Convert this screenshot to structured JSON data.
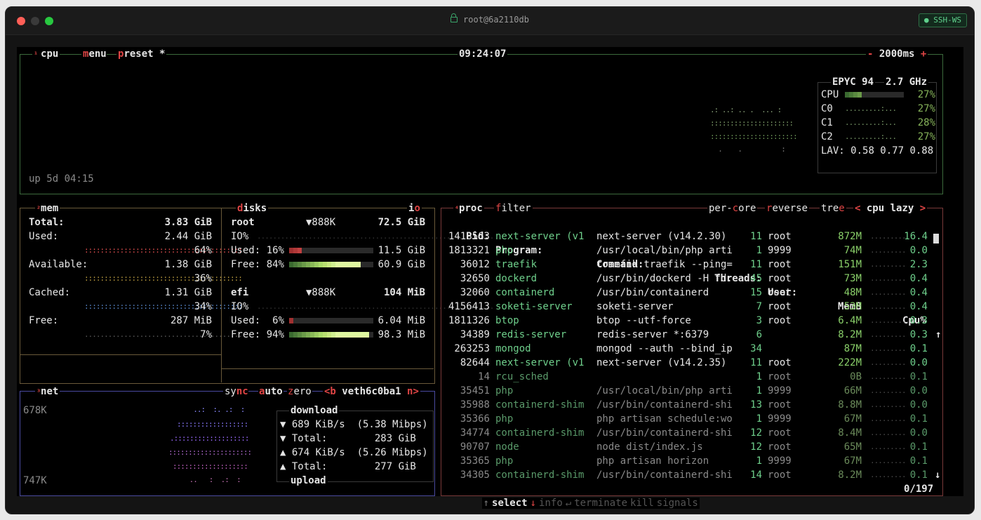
{
  "window": {
    "title": "root@6a2110db",
    "badge": "● SSH-WS",
    "colors": {
      "close": "#ff5f57",
      "minimize": "#3a3a3a",
      "zoom": "#28c840"
    }
  },
  "cpu": {
    "num": "¹",
    "title": "cpu",
    "menu_hot": "m",
    "menu": "enu",
    "preset_hot": "p",
    "preset": "reset *",
    "clock": "09:24:07",
    "minus": "-",
    "interval": "2000ms",
    "plus": "+",
    "uptime": "up 5d 04:15",
    "model": "EPYC 94",
    "freq": "2.7 GHz",
    "cores": [
      {
        "label": "CPU",
        "pct": "27%",
        "value": 27
      },
      {
        "label": "C0",
        "pct": "27%",
        "value": 27
      },
      {
        "label": "C1",
        "pct": "28%",
        "value": 28
      },
      {
        "label": "C2",
        "pct": "27%",
        "value": 27
      }
    ],
    "lav_label": "LAV:",
    "lav": "0.58 0.77 0.88"
  },
  "mem": {
    "num": "²",
    "title": "mem",
    "disks_hot": "d",
    "disks": "isks",
    "io_pre": "i",
    "io_hot": "o",
    "rows": [
      {
        "label": "Total:",
        "value": "3.83 GiB"
      },
      {
        "label": "Used:",
        "value": "2.44 GiB",
        "pct": "64%",
        "value_pct": 64
      },
      {
        "label": "Available:",
        "value": "1.38 GiB",
        "pct": "36%",
        "value_pct": 36
      },
      {
        "label": "Cached:",
        "value": "1.31 GiB",
        "pct": "34%",
        "value_pct": 34
      },
      {
        "label": "Free:",
        "value": "287 MiB",
        "pct": "7%",
        "value_pct": 7
      }
    ],
    "disk_list": [
      {
        "name": "root",
        "io_rate": "▼888K",
        "size": "72.5 GiB",
        "io_label": "IO%",
        "used_label": "Used:",
        "used_pct": "16%",
        "used_value": 16,
        "used": "11.5 GiB",
        "free_label": "Free:",
        "free_pct": "84%",
        "free_value": 84,
        "free": "60.9 GiB"
      },
      {
        "name": "efi",
        "io_rate": "▼888K",
        "size": "104 MiB",
        "io_label": "IO%",
        "used_label": "Used:",
        "used_pct": "6%",
        "used_value": 6,
        "used": "6.04 MiB",
        "free_label": "Free:",
        "free_pct": "94%",
        "free_value": 94,
        "free": "98.3 MiB"
      }
    ]
  },
  "net": {
    "num": "³",
    "title": "net",
    "sync_hot": "sy",
    "sync_rest": "nc",
    "auto_hot": "a",
    "auto": "uto",
    "zero_hot": "z",
    "zero": "ero",
    "prev": "<b",
    "iface": "veth6c0ba1",
    "next": "n>",
    "top_scale": "678K",
    "bottom_scale": "747K",
    "download": "download",
    "dl_rate": "▼ 689 KiB/s  (5.38 Mibps)",
    "dl_total": "▼ Total:        283 GiB",
    "ul_rate": "▲ 674 KiB/s  (5.26 Mibps)",
    "ul_total": "▲ Total:        277 GiB",
    "upload": "upload"
  },
  "proc": {
    "num": "⁴",
    "title": "proc",
    "filter_hot": "f",
    "filter": "ilter",
    "percore_pre": "per-",
    "percore_hot": "c",
    "percore_post": "ore",
    "reverse_hot": "r",
    "reverse": "everse",
    "tree_pre": "tre",
    "tree_hot": "e",
    "sort_left": "<",
    "sort": "cpu lazy",
    "sort_right": ">",
    "headers": {
      "pid": "Pid:",
      "program": "Program:",
      "command": "Command:",
      "threads": "Threads:",
      "user": "User:",
      "memb": "MemB",
      "cpu": "Cpu%",
      "arrow": "↑"
    },
    "rows": [
      {
        "pid": "1418563",
        "program": "next-server (v1",
        "command": "next-server (v14.2.30)",
        "threads": "11",
        "user": "root",
        "mem": "872M",
        "cpu": "16.4",
        "bright": true
      },
      {
        "pid": "1813321",
        "program": "php",
        "command": "/usr/local/bin/php arti",
        "threads": "1",
        "user": "9999",
        "mem": "74M",
        "cpu": "0.0",
        "bright": true
      },
      {
        "pid": "36012",
        "program": "traefik",
        "command": "traefik traefik --ping=",
        "threads": "11",
        "user": "root",
        "mem": "151M",
        "cpu": "2.3",
        "bright": true
      },
      {
        "pid": "32650",
        "program": "dockerd",
        "command": "/usr/bin/dockerd -H fd:",
        "threads": "45",
        "user": "root",
        "mem": "73M",
        "cpu": "0.4",
        "bright": true
      },
      {
        "pid": "32060",
        "program": "containerd",
        "command": "/usr/bin/containerd",
        "threads": "15",
        "user": "root",
        "mem": "48M",
        "cpu": "0.4",
        "bright": true
      },
      {
        "pid": "4156413",
        "program": "soketi-server",
        "command": "soketi-server",
        "threads": "7",
        "user": "root",
        "mem": "53M",
        "cpu": "0.4",
        "bright": true
      },
      {
        "pid": "1811326",
        "program": "btop",
        "command": "btop --utf-force",
        "threads": "3",
        "user": "root",
        "mem": "6.4M",
        "cpu": "0.3",
        "bright": true
      },
      {
        "pid": "34389",
        "program": "redis-server",
        "command": "redis-server *:6379",
        "threads": "6",
        "user": "",
        "mem": "8.2M",
        "cpu": "0.3",
        "bright": true
      },
      {
        "pid": "263253",
        "program": "mongod",
        "command": "mongod --auth --bind_ip",
        "threads": "34",
        "user": "",
        "mem": "87M",
        "cpu": "0.1",
        "bright": true
      },
      {
        "pid": "82644",
        "program": "next-server (v1",
        "command": "next-server (v14.2.35)",
        "threads": "11",
        "user": "root",
        "mem": "222M",
        "cpu": "0.0",
        "bright": true
      },
      {
        "pid": "14",
        "program": "rcu_sched",
        "command": "",
        "threads": "1",
        "user": "root",
        "mem": "0B",
        "cpu": "0.1",
        "bright": false
      },
      {
        "pid": "35451",
        "program": "php",
        "command": "/usr/local/bin/php arti",
        "threads": "1",
        "user": "9999",
        "mem": "66M",
        "cpu": "0.0",
        "bright": false
      },
      {
        "pid": "35988",
        "program": "containerd-shim",
        "command": "/usr/bin/containerd-shi",
        "threads": "13",
        "user": "root",
        "mem": "8.8M",
        "cpu": "0.0",
        "bright": false
      },
      {
        "pid": "35366",
        "program": "php",
        "command": "php artisan schedule:wo",
        "threads": "1",
        "user": "9999",
        "mem": "67M",
        "cpu": "0.1",
        "bright": false
      },
      {
        "pid": "34774",
        "program": "containerd-shim",
        "command": "/usr/bin/containerd-shi",
        "threads": "12",
        "user": "root",
        "mem": "8.4M",
        "cpu": "0.0",
        "bright": false
      },
      {
        "pid": "90707",
        "program": "node",
        "command": "node dist/index.js",
        "threads": "12",
        "user": "root",
        "mem": "65M",
        "cpu": "0.1",
        "bright": false
      },
      {
        "pid": "35365",
        "program": "php",
        "command": "php artisan horizon",
        "threads": "1",
        "user": "9999",
        "mem": "67M",
        "cpu": "0.1",
        "bright": false
      },
      {
        "pid": "34305",
        "program": "containerd-shim",
        "command": "/usr/bin/containerd-shi",
        "threads": "14",
        "user": "root",
        "mem": "8.2M",
        "cpu": "0.1",
        "bright": false
      }
    ],
    "bottom_up": "↑",
    "select": "select",
    "bottom_down": "↓",
    "info": "info",
    "info_key": "↵",
    "terminate": "terminate",
    "kill": "kill",
    "signals": "signals",
    "count": "0/197",
    "scroll_down": "↓"
  }
}
